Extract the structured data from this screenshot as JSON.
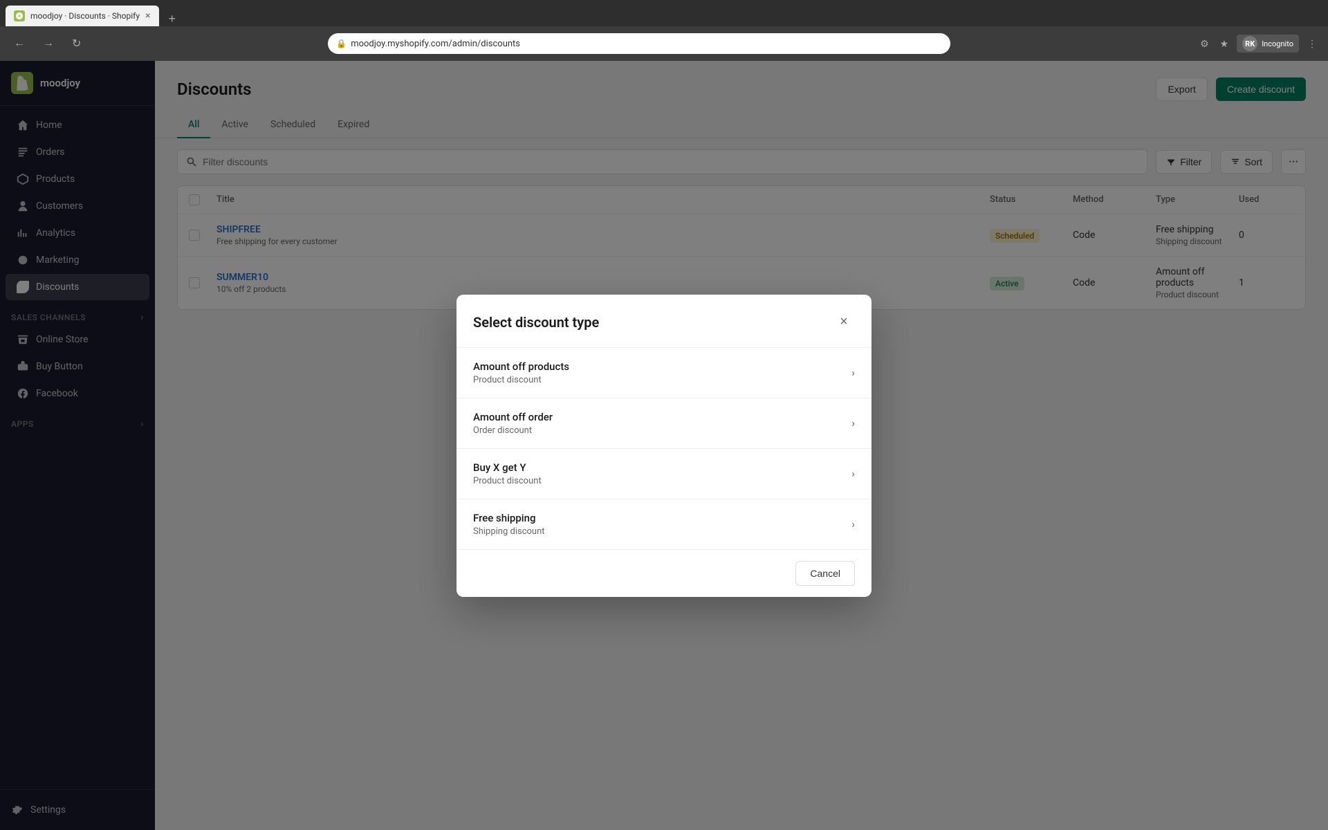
{
  "browser": {
    "tab_favicon": "shopify",
    "tab_title": "moodjoy · Discounts · Shopify",
    "tab_close": "×",
    "new_tab": "+",
    "nav_back": "←",
    "nav_forward": "→",
    "nav_refresh": "↻",
    "address": "moodjoy.myshopify.com/admin/discounts",
    "incognito_initials": "RK",
    "incognito_label": "Incognito",
    "menu_icon": "⋮"
  },
  "sidebar": {
    "logo_alt": "Shopify",
    "store_name": "moodjoy",
    "nav_items": [
      {
        "id": "home",
        "label": "Home",
        "icon": "home"
      },
      {
        "id": "orders",
        "label": "Orders",
        "icon": "orders"
      },
      {
        "id": "products",
        "label": "Products",
        "icon": "products"
      },
      {
        "id": "customers",
        "label": "Customers",
        "icon": "customers"
      },
      {
        "id": "analytics",
        "label": "Analytics",
        "icon": "analytics"
      },
      {
        "id": "marketing",
        "label": "Marketing",
        "icon": "marketing"
      },
      {
        "id": "discounts",
        "label": "Discounts",
        "icon": "discounts",
        "active": true
      }
    ],
    "sales_channels_label": "Sales channels",
    "sales_channels": [
      {
        "id": "online-store",
        "label": "Online Store"
      },
      {
        "id": "buy-button",
        "label": "Buy Button"
      },
      {
        "id": "facebook",
        "label": "Facebook"
      }
    ],
    "apps_label": "Apps",
    "settings_label": "Settings"
  },
  "page": {
    "title": "Discounts",
    "export_label": "Export",
    "create_discount_label": "Create discount"
  },
  "tabs": [
    {
      "id": "all",
      "label": "All",
      "active": true
    },
    {
      "id": "active",
      "label": "Active"
    },
    {
      "id": "scheduled",
      "label": "Scheduled"
    },
    {
      "id": "expired",
      "label": "Expired"
    }
  ],
  "toolbar": {
    "search_placeholder": "Filter discounts",
    "filter_label": "Filter",
    "sort_label": "Sort",
    "more_icon": "···"
  },
  "table": {
    "columns": [
      "",
      "Title",
      "Status",
      "Method",
      "Type",
      "Used"
    ],
    "rows": [
      {
        "id": "row1",
        "title": "SHIPFREE",
        "subtitle": "Free shipping for every customer",
        "status": "Scheduled",
        "status_type": "scheduled",
        "method": "Code",
        "type": "Free shipping",
        "type_sub": "Shipping discount",
        "used": "0"
      },
      {
        "id": "row2",
        "title": "SUMMER10",
        "subtitle": "10% off 2 products",
        "status": "Active",
        "status_type": "active",
        "method": "Code",
        "type": "Amount off products",
        "type_sub": "Product discount",
        "used": "1"
      }
    ]
  },
  "modal": {
    "title": "Select discount type",
    "close_icon": "×",
    "options": [
      {
        "id": "amount-off-products",
        "title": "Amount off products",
        "subtitle": "Product discount"
      },
      {
        "id": "amount-off-order",
        "title": "Amount off order",
        "subtitle": "Order discount"
      },
      {
        "id": "buy-x-get-y",
        "title": "Buy X get Y",
        "subtitle": "Product discount"
      },
      {
        "id": "free-shipping",
        "title": "Free shipping",
        "subtitle": "Shipping discount"
      }
    ],
    "cancel_label": "Cancel"
  }
}
